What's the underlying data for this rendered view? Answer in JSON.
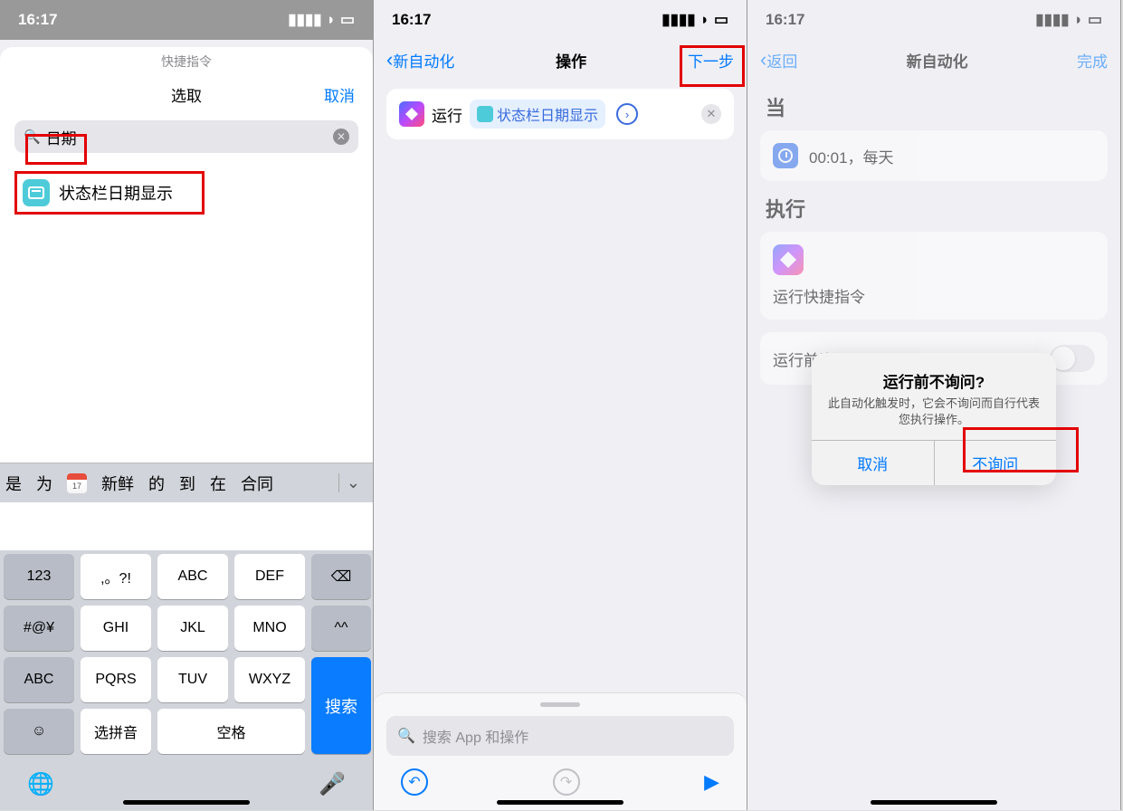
{
  "statusbar": {
    "time": "16:17"
  },
  "screen1": {
    "app_title": "快捷指令",
    "select_title": "选取",
    "cancel": "取消",
    "search_value": "日期",
    "result": "状态栏日期显示",
    "candidates": [
      "是",
      "为",
      "新鲜",
      "的",
      "到",
      "在",
      "合同"
    ],
    "cal_num": "17",
    "keys": {
      "k123": "123",
      "punct": ",。?!",
      "abc1": "ABC",
      "def": "DEF",
      "sym": "#@¥",
      "ghi": "GHI",
      "jkl": "JKL",
      "mno": "MNO",
      "face": "^^",
      "abc2": "ABC",
      "pqrs": "PQRS",
      "tuv": "TUV",
      "wxyz": "WXYZ",
      "search": "搜索",
      "pinyin": "选拼音",
      "space": "空格"
    }
  },
  "screen2": {
    "back": "新自动化",
    "title": "操作",
    "next": "下一步",
    "run_label": "运行",
    "pill_text": "状态栏日期显示",
    "search_placeholder": "搜索 App 和操作"
  },
  "screen3": {
    "back": "返回",
    "title": "新自动化",
    "done": "完成",
    "when_label": "当",
    "when_value": "00:01，每天",
    "do_label": "执行",
    "do_value": "运行快捷指令",
    "ask_row": "运行前询问",
    "alert_title": "运行前不询问?",
    "alert_msg": "此自动化触发时，它会不询问而自行代表您执行操作。",
    "alert_cancel": "取消",
    "alert_confirm": "不询问"
  }
}
